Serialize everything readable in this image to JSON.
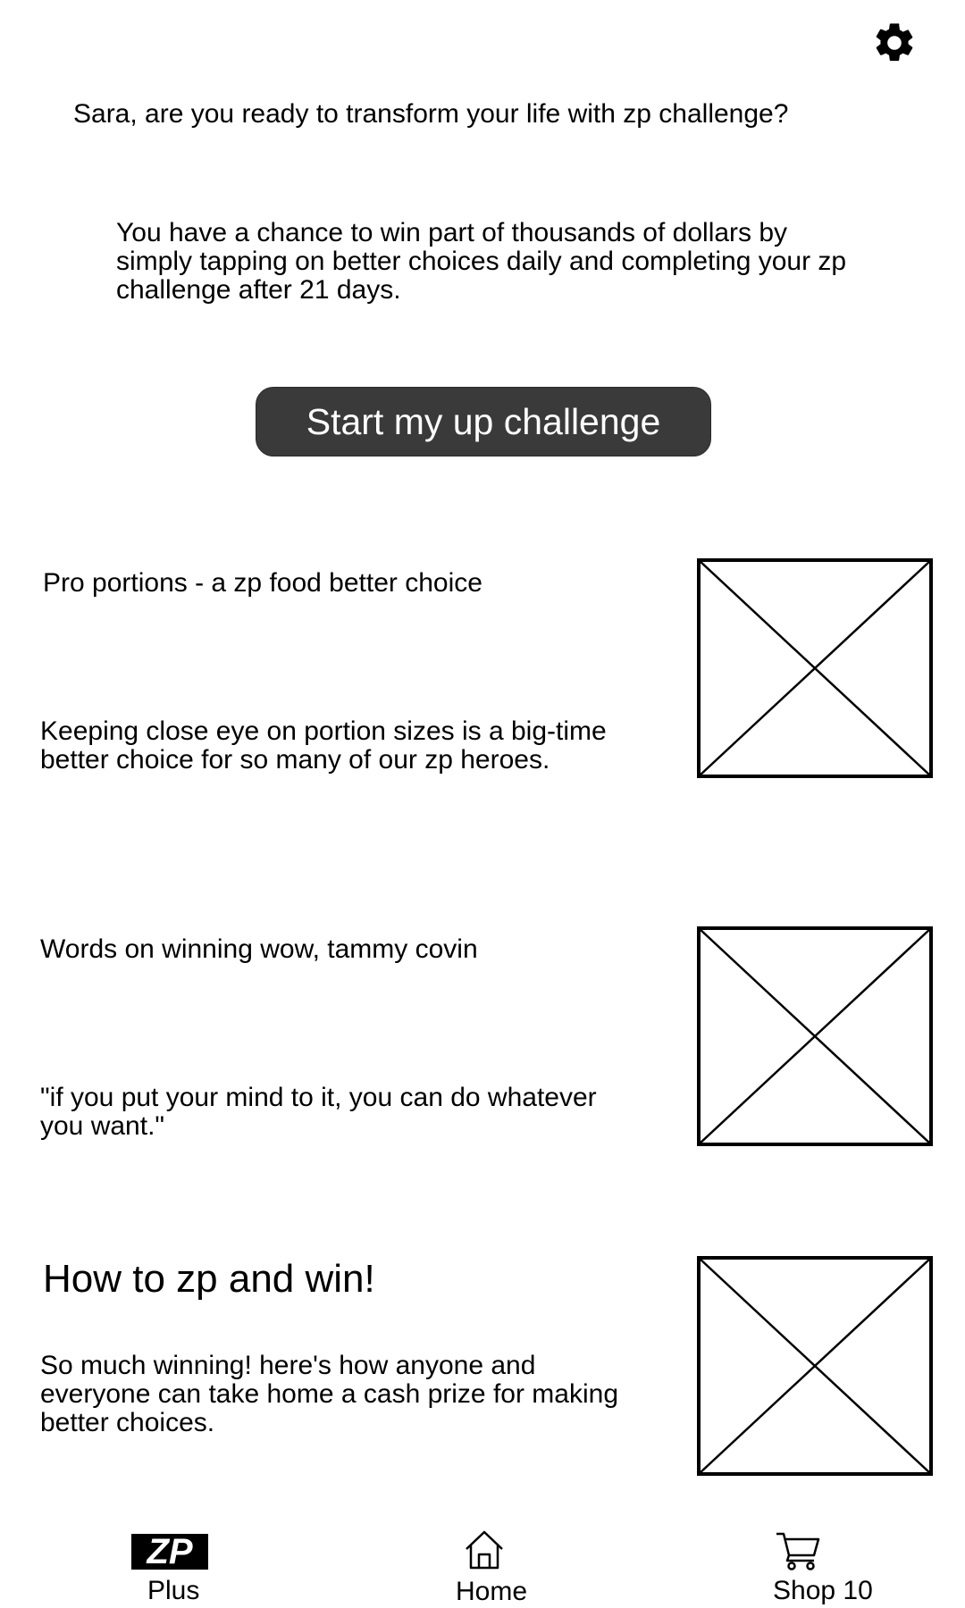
{
  "header": {
    "settings_icon": "gear-icon"
  },
  "greeting": "Sara, are you ready to transform your life with zp challenge?",
  "intro": "You have a chance to win part of thousands of dollars by simply tapping on better choices daily and completing your zp challenge after 21 days.",
  "cta": {
    "label": "Start my up challenge"
  },
  "cards": [
    {
      "title": "Pro portions - a zp food better choice",
      "body": "Keeping close eye on portion sizes is a big-time better choice for so many of our zp heroes."
    },
    {
      "title": "Words on winning wow, tammy covin",
      "body": "\"if you put your mind to it, you can do whatever you want.\""
    },
    {
      "title": "How to zp and win!",
      "body": "So much winning! here's how anyone and everyone can take home a cash prize for making better choices."
    }
  ],
  "bottom_nav": [
    {
      "label": "Plus",
      "icon": "zp-logo-icon",
      "logo_text": "ZP"
    },
    {
      "label": "Home",
      "icon": "home-icon"
    },
    {
      "label": "Shop 10",
      "icon": "cart-icon"
    }
  ]
}
